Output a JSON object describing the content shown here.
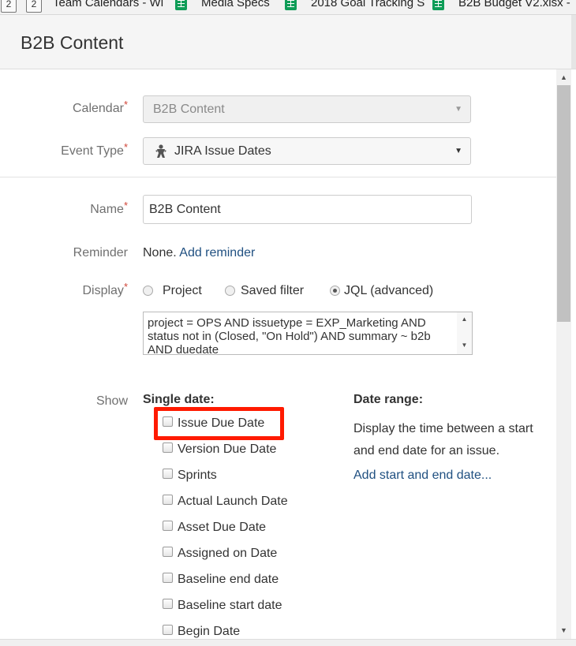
{
  "bookmarks": [
    {
      "label": "Team Calendars - Wi",
      "icon": "calendar-box-icon",
      "badge": "2"
    },
    {
      "label": "Media Specs",
      "icon": "sheets-icon"
    },
    {
      "label": "2018 Goal Tracking S",
      "icon": "sheets-icon"
    },
    {
      "label": "B2B Budget V2.xlsx -",
      "icon": "sheets-icon"
    }
  ],
  "leading_badge": "2",
  "dialog": {
    "title": "B2B Content"
  },
  "form": {
    "calendar": {
      "label": "Calendar",
      "value": "B2B Content"
    },
    "event_type": {
      "label": "Event Type",
      "value": "JIRA Issue Dates"
    },
    "name": {
      "label": "Name",
      "value": "B2B Content"
    },
    "reminder": {
      "label": "Reminder",
      "value": "None.",
      "link": "Add reminder"
    },
    "display": {
      "label": "Display",
      "options": [
        "Project",
        "Saved filter",
        "JQL (advanced)"
      ],
      "selected": "JQL (advanced)",
      "jql": "project = OPS AND issuetype = EXP_Marketing AND status not in (Closed, \"On Hold\") AND summary ~ b2b AND duedate"
    },
    "show": {
      "label": "Show",
      "single_date_heading": "Single date:",
      "single_dates": [
        "Issue Due Date",
        "Version Due Date",
        "Sprints",
        "Actual Launch Date",
        "Asset Due Date",
        "Assigned on Date",
        "Baseline end date",
        "Baseline start date",
        "Begin Date"
      ],
      "date_range_heading": "Date range:",
      "date_range_text": "Display the time between a start and end date for an issue.",
      "date_range_link": "Add start and end date..."
    }
  },
  "required_marker": "*",
  "colors": {
    "highlight": "#ff1a00",
    "link": "#205081",
    "required": "#d04437"
  }
}
